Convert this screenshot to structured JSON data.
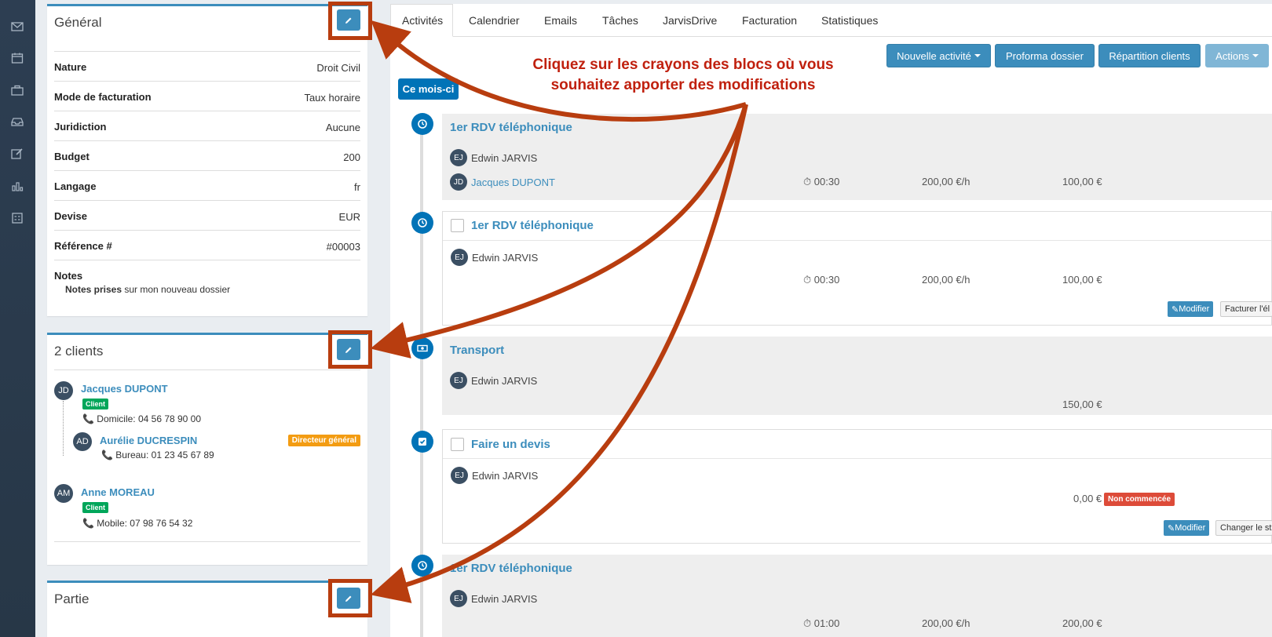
{
  "sidebar": {
    "icons": [
      "mail-icon",
      "calendar-icon",
      "briefcase-icon",
      "inbox-tray-icon",
      "edit-icon",
      "bar-chart-icon",
      "calculator-icon"
    ]
  },
  "general": {
    "title": "Général",
    "rows": [
      {
        "key": "Nature",
        "value": "Droit Civil"
      },
      {
        "key": "Mode de facturation",
        "value": "Taux horaire"
      },
      {
        "key": "Juridiction",
        "value": "Aucune"
      },
      {
        "key": "Budget",
        "value": "200"
      },
      {
        "key": "Langage",
        "value": "fr"
      },
      {
        "key": "Devise",
        "value": "EUR"
      },
      {
        "key": "Référence #",
        "value": "#00003"
      }
    ],
    "notes_label": "Notes",
    "notes_bold": "Notes prises",
    "notes_rest": " sur mon nouveau dossier"
  },
  "clients": {
    "title": "2 clients",
    "list": [
      {
        "initials": "JD",
        "name": "Jacques DUPONT",
        "badge": "Client",
        "phone": "Domicile: 04 56 78 90 00"
      },
      {
        "initials": "AD",
        "name": "Aurélie DUCRESPIN",
        "role": "Directeur général",
        "phone": "Bureau: 01 23 45 67 89"
      },
      {
        "initials": "AM",
        "name": "Anne MOREAU",
        "badge": "Client",
        "phone": "Mobile: 07 98 76 54 32"
      }
    ]
  },
  "partie": {
    "title": "Partie"
  },
  "tabs": [
    "Activités",
    "Calendrier",
    "Emails",
    "Tâches",
    "JarvisDrive",
    "Facturation",
    "Statistiques"
  ],
  "toolbar": {
    "new_activity": "Nouvelle activité",
    "proforma": "Proforma dossier",
    "repartition": "Répartition clients",
    "actions": "Actions"
  },
  "month_label": "Ce mois-ci",
  "timeline": [
    {
      "icon": "clock-icon",
      "title": "1er RDV téléphonique",
      "person1": {
        "initials": "EJ",
        "name": "Edwin JARVIS"
      },
      "person2": {
        "initials": "JD",
        "name": "Jacques DUPONT"
      },
      "duration": "00:30",
      "rate": "200,00 €/h",
      "amount": "100,00 €"
    },
    {
      "icon": "clock-icon",
      "title": "1er RDV téléphonique",
      "person1": {
        "initials": "EJ",
        "name": "Edwin JARVIS"
      },
      "duration": "00:30",
      "rate": "200,00 €/h",
      "amount": "100,00 €",
      "btn_modify": "Modifier",
      "btn_other": "Facturer l'él"
    },
    {
      "icon": "money-icon",
      "title": "Transport",
      "person1": {
        "initials": "EJ",
        "name": "Edwin JARVIS"
      },
      "amount": "150,00 €"
    },
    {
      "icon": "check-square-icon",
      "title": "Faire un devis",
      "person1": {
        "initials": "EJ",
        "name": "Edwin JARVIS"
      },
      "amount": "0,00 €",
      "status": "Non commencée",
      "btn_modify": "Modifier",
      "btn_other": "Changer le st"
    },
    {
      "icon": "clock-icon",
      "title": "1er RDV téléphonique",
      "person1": {
        "initials": "EJ",
        "name": "Edwin JARVIS"
      },
      "duration": "01:00",
      "rate": "200,00 €/h",
      "amount": "200,00 €"
    }
  ],
  "callout": {
    "line1": "Cliquez sur les crayons des blocs où vous",
    "line2": "souhaitez apporter des modifications",
    "color": "#c0200e"
  }
}
